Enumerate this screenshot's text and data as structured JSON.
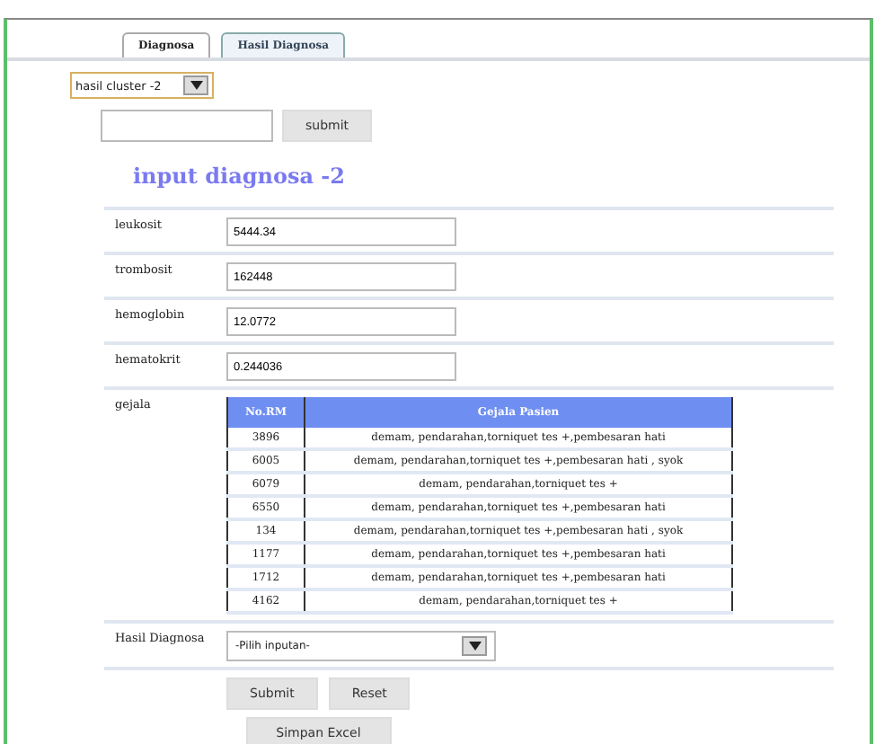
{
  "tabs": [
    {
      "label": "Diagnosa",
      "selected": false
    },
    {
      "label": "Hasil Diagnosa",
      "selected": true
    }
  ],
  "cluster_select": {
    "value": "hasil cluster -2"
  },
  "search": {
    "button": "submit"
  },
  "heading": "input diagnosa -2",
  "fields": [
    {
      "label": "leukosit",
      "value": "5444.34"
    },
    {
      "label": "trombosit",
      "value": "162448"
    },
    {
      "label": "hemoglobin",
      "value": "12.0772"
    },
    {
      "label": "hematokrit",
      "value": "0.244036"
    }
  ],
  "gejala": {
    "label": "gejala",
    "columns": [
      "No.RM",
      "Gejala Pasien"
    ],
    "rows": [
      [
        "3896",
        "demam, pendarahan,torniquet tes +,pembesaran hati"
      ],
      [
        "6005",
        "demam, pendarahan,torniquet tes +,pembesaran hati , syok"
      ],
      [
        "6079",
        "demam, pendarahan,torniquet tes +"
      ],
      [
        "6550",
        "demam, pendarahan,torniquet tes +,pembesaran hati"
      ],
      [
        "134",
        "demam, pendarahan,torniquet tes +,pembesaran hati , syok"
      ],
      [
        "1177",
        "demam, pendarahan,torniquet tes +,pembesaran hati"
      ],
      [
        "1712",
        "demam, pendarahan,torniquet tes +,pembesaran hati"
      ],
      [
        "4162",
        "demam, pendarahan,torniquet tes +"
      ]
    ]
  },
  "hasil": {
    "label": "Hasil Diagnosa",
    "placeholder": "-Pilih inputan-"
  },
  "buttons": [
    "Submit",
    "Reset",
    "Simpan Excel"
  ]
}
